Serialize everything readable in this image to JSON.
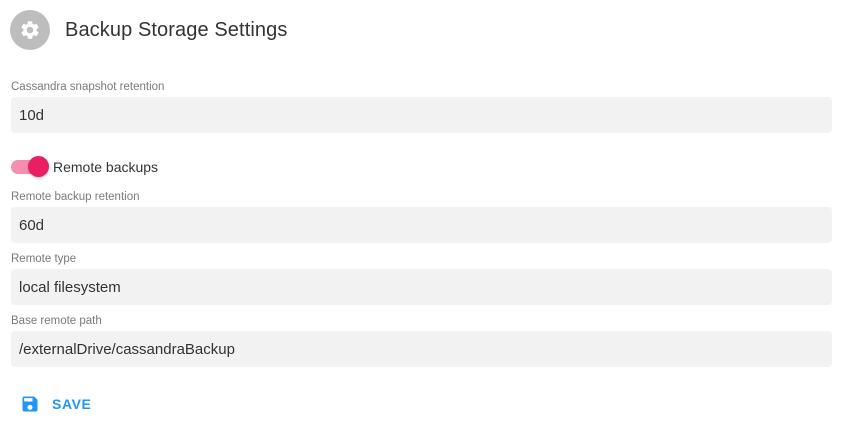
{
  "header": {
    "title": "Backup Storage Settings",
    "icon": "gear-icon"
  },
  "fields": {
    "snapshot_retention": {
      "label": "Cassandra snapshot retention",
      "value": "10d"
    },
    "remote_retention": {
      "label": "Remote backup retention",
      "value": "60d"
    },
    "remote_type": {
      "label": "Remote type",
      "value": "local filesystem"
    },
    "base_remote_path": {
      "label": "Base remote path",
      "value": "/externalDrive/cassandraBackup"
    }
  },
  "remote_backups": {
    "label": "Remote backups",
    "enabled": true
  },
  "actions": {
    "save_label": "SAVE",
    "save_icon": "floppy-disk-icon"
  },
  "colors": {
    "accent": "#2196f3",
    "toggle_thumb": "#e91e63",
    "toggle_track": "#f48fb1",
    "avatar_bg": "#bdbdbd",
    "field_bg": "#f2f2f2"
  }
}
